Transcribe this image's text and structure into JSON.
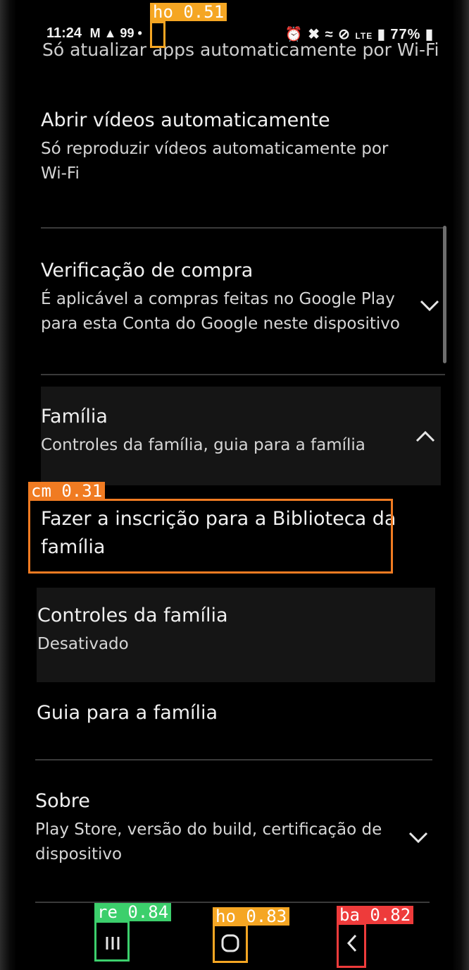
{
  "status_bar": {
    "time": "11:24",
    "left_extras": "M ▲ 99 •",
    "battery": "77%"
  },
  "settings": {
    "cut_text": "Só atualizar apps automaticamente por Wi-Fi",
    "items": [
      {
        "title": "Abrir vídeos automaticamente",
        "subtitle": "Só reproduzir vídeos automaticamente por Wi-Fi"
      },
      {
        "title": "Verificação de compra",
        "subtitle": "É aplicável a compras feitas no Google Play para esta Conta do Google neste dispositivo"
      },
      {
        "title": "Família",
        "subtitle": "Controles da família, guia para a família"
      },
      {
        "title": "Fazer a inscrição para a Biblioteca da família"
      },
      {
        "title": "Controles da família",
        "subtitle": "Desativado"
      },
      {
        "title": "Guia para a família"
      },
      {
        "title": "Sobre",
        "subtitle": "Play Store, versão do build, certificação de dispositivo"
      }
    ]
  },
  "icons": {
    "chevron_down": "chevron-down-icon",
    "chevron_up": "chevron-up-icon",
    "recents": "recents-icon",
    "home": "home-icon",
    "back": "back-icon"
  },
  "detections": [
    {
      "label": "ho 0.51",
      "color": "#f5a623"
    },
    {
      "label": "cm 0.31",
      "color": "#f07b22"
    },
    {
      "label": "re 0.84",
      "color": "#3ccf6c"
    },
    {
      "label": "ho 0.83",
      "color": "#f5a623"
    },
    {
      "label": "ba 0.82",
      "color": "#ee3b3b"
    }
  ]
}
